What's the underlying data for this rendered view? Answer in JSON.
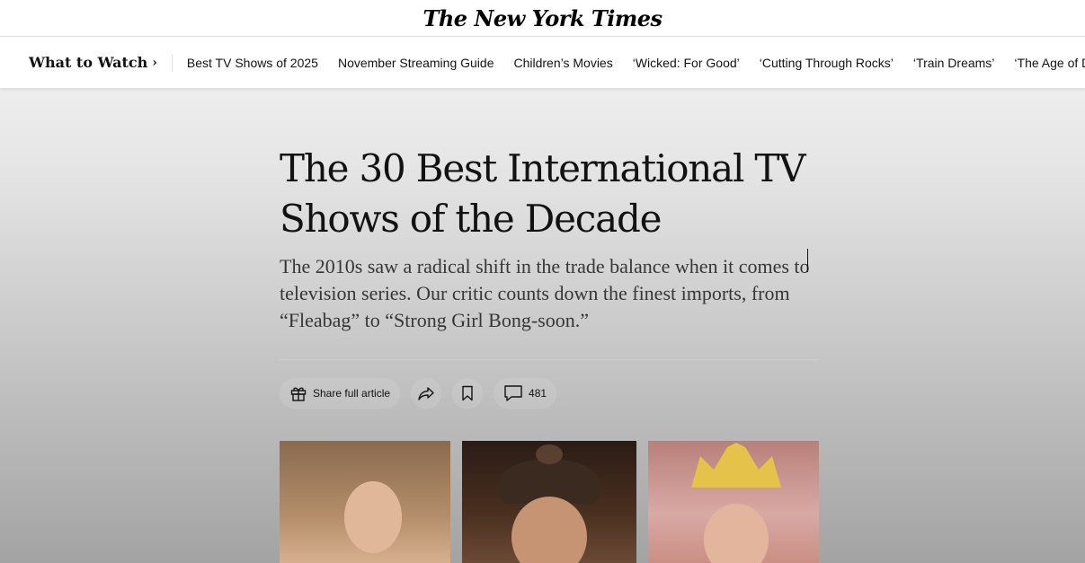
{
  "masthead": {
    "logo": "The New York Times"
  },
  "subnav": {
    "title": "What to Watch",
    "chevron": "›",
    "links": [
      "Best TV Shows of 2025",
      "November Streaming Guide",
      "Children’s Movies",
      "‘Wicked: For Good’",
      "‘Cutting Through Rocks’",
      "‘Train Dreams’",
      "‘The Age of Disclosure’"
    ]
  },
  "article": {
    "headline": "The 30 Best International TV Shows of the Decade",
    "summary": "The 2010s saw a radical shift in the trade balance when it comes to television series. Our critic counts down the finest imports, from “Fleabag” to “Strong Girl Bong-soon.”"
  },
  "tools": {
    "share_full_label": "Share full article",
    "share_full_icon": "gift-icon",
    "share_icon": "share-arrow-icon",
    "save_icon": "bookmark-icon",
    "comments_icon": "comment-bubble-icon",
    "comments_count": "481"
  },
  "colors": {
    "text": "#121212",
    "background_top": "#f7f7f7",
    "background_bottom": "#a3a3a3"
  }
}
